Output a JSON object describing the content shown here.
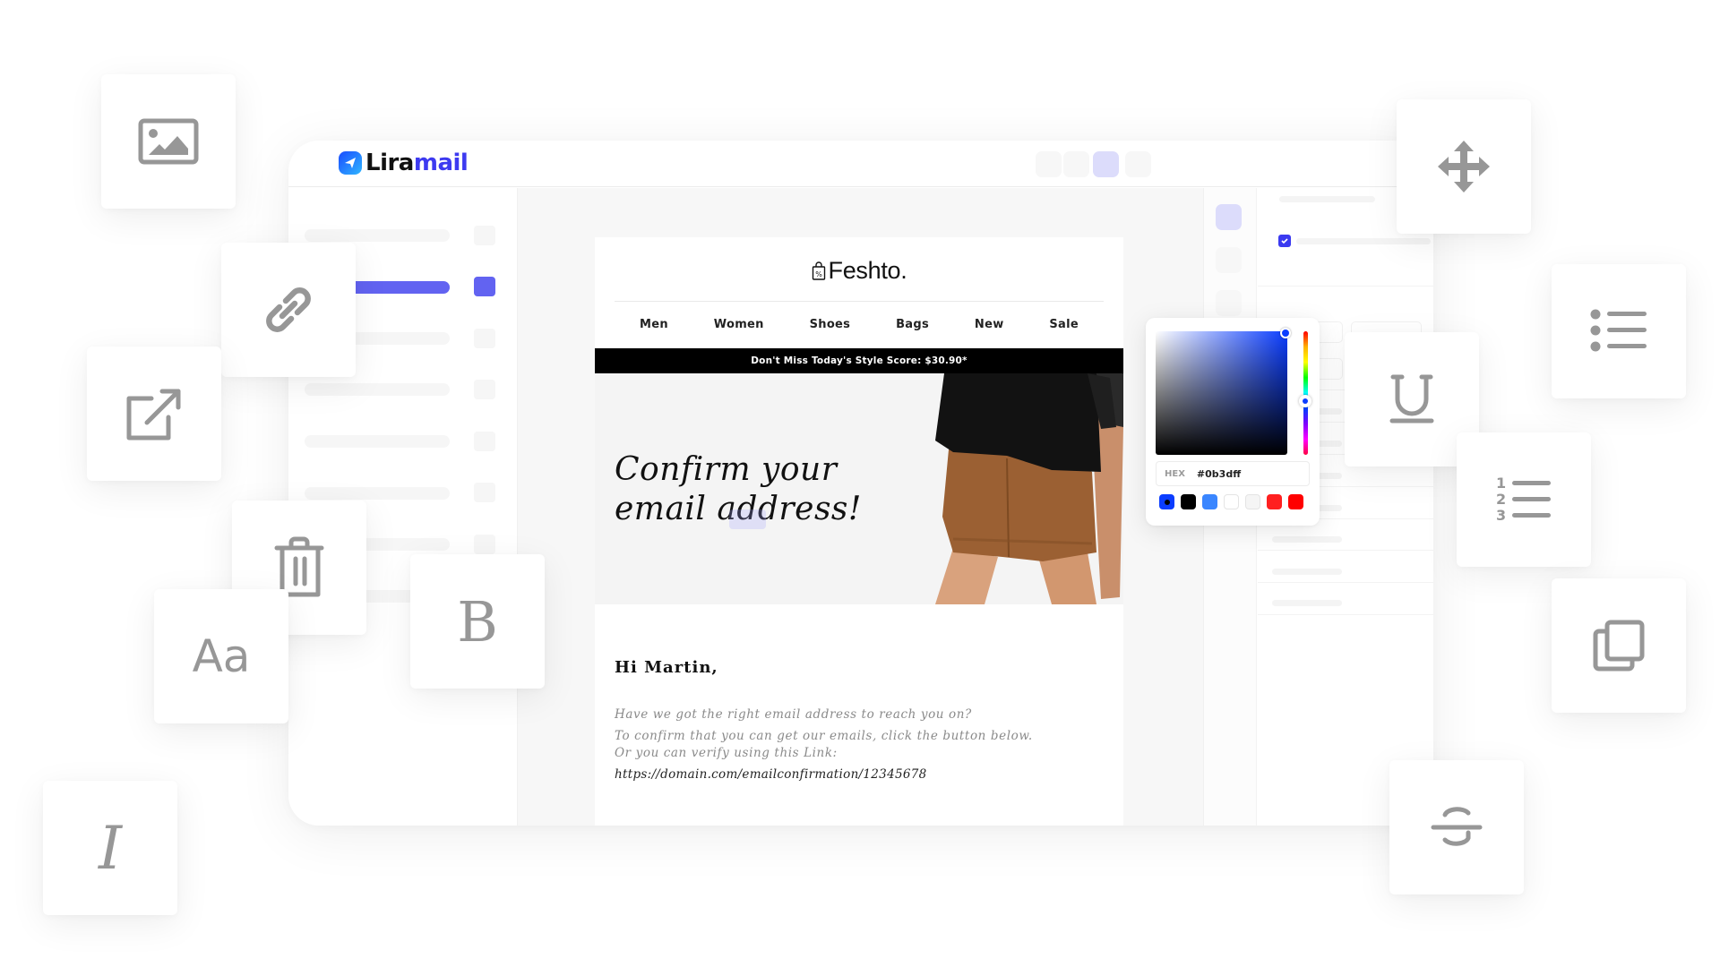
{
  "app": {
    "logo_part1": "Lira",
    "logo_part2": "mail",
    "logo_icon": "paper-plane-icon",
    "accent_color": "#6263f1"
  },
  "email": {
    "brand": "Feshto.",
    "brand_icon": "shopping-bag-percent-icon",
    "nav": [
      "Men",
      "Women",
      "Shoes",
      "Bags",
      "New",
      "Sale"
    ],
    "promo": "Don't Miss Today's Style Score: $30.90*",
    "hero_title": "Confirm your\nemail address!",
    "greeting": "Hi Martin,",
    "body_line1": "Have we got the right email address to reach you on?",
    "body_line2": "To confirm that you can get our emails, click the button below.",
    "verify_label": "Or you can verify using this Link:",
    "verify_link": "https://domain.com/emailconfirmation/12345678"
  },
  "color_picker": {
    "hex_label": "HEX",
    "hex_value": "#0b3dff",
    "swatches": [
      "#0b3dff",
      "#000000",
      "#3a86ff",
      "#ffffff",
      "#f5f5f5",
      "#ff2020",
      "#ff0000"
    ],
    "selected_swatch": 0
  },
  "tiles": {
    "image": "image-icon",
    "link": "link-icon",
    "external": "external-link-icon",
    "delete": "trash-icon",
    "font": "Aa",
    "bold": "B",
    "italic": "I",
    "move": "move-icon",
    "bulleted_list": "bulleted-list-icon",
    "underline": "U",
    "numbered_list": "numbered-list-icon",
    "duplicate": "copy-icon",
    "strikethrough": "S"
  }
}
